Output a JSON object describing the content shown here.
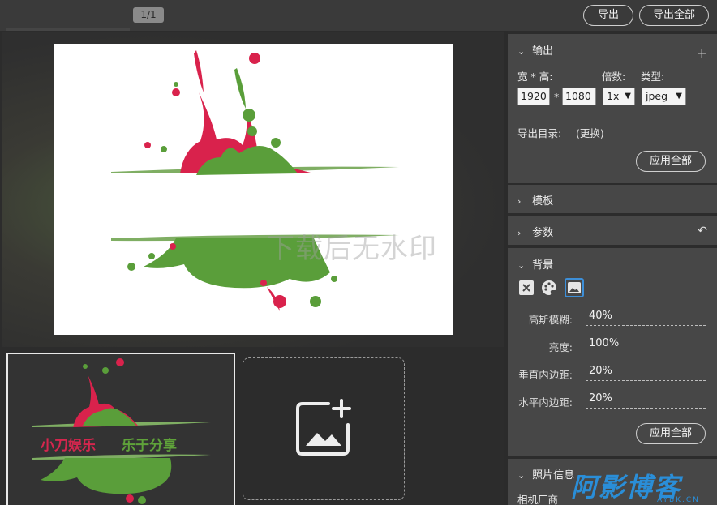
{
  "topbar": {
    "page_indicator": "1/1",
    "export_label": "导出",
    "export_all_label": "导出全部"
  },
  "preview": {
    "watermark_text": "下载后无水印"
  },
  "thumbnail": {
    "text_red": "小刀娱乐",
    "text_green": "乐于分享"
  },
  "panel": {
    "output": {
      "title": "输出",
      "size_label": "宽 * 高:",
      "multiplier_label": "倍数:",
      "type_label": "类型:",
      "width_value": "1920",
      "times_sign": "*",
      "height_value": "1080",
      "multiplier_value": "1x",
      "type_value": "jpeg",
      "dir_label": "导出目录:",
      "dir_change": "(更换)",
      "apply_label": "应用全部"
    },
    "template": {
      "title": "模板"
    },
    "params": {
      "title": "参数"
    },
    "background": {
      "title": "背景",
      "icons": [
        "close-icon",
        "palette-icon",
        "image-icon"
      ],
      "rows": [
        {
          "label": "高斯模糊:",
          "value": "40%"
        },
        {
          "label": "亮度:",
          "value": "100%"
        },
        {
          "label": "垂直内边距:",
          "value": "20%"
        },
        {
          "label": "水平内边距:",
          "value": "20%"
        }
      ],
      "apply_label": "应用全部"
    },
    "photo": {
      "title": "照片信息",
      "camera_label": "相机厂商"
    }
  },
  "brand": {
    "name": "阿影博客",
    "domain": "AYBK.CN"
  },
  "colors": {
    "accent_red": "#d9224c",
    "accent_green": "#5a9e3a",
    "brand_blue": "#2a8ed8"
  }
}
